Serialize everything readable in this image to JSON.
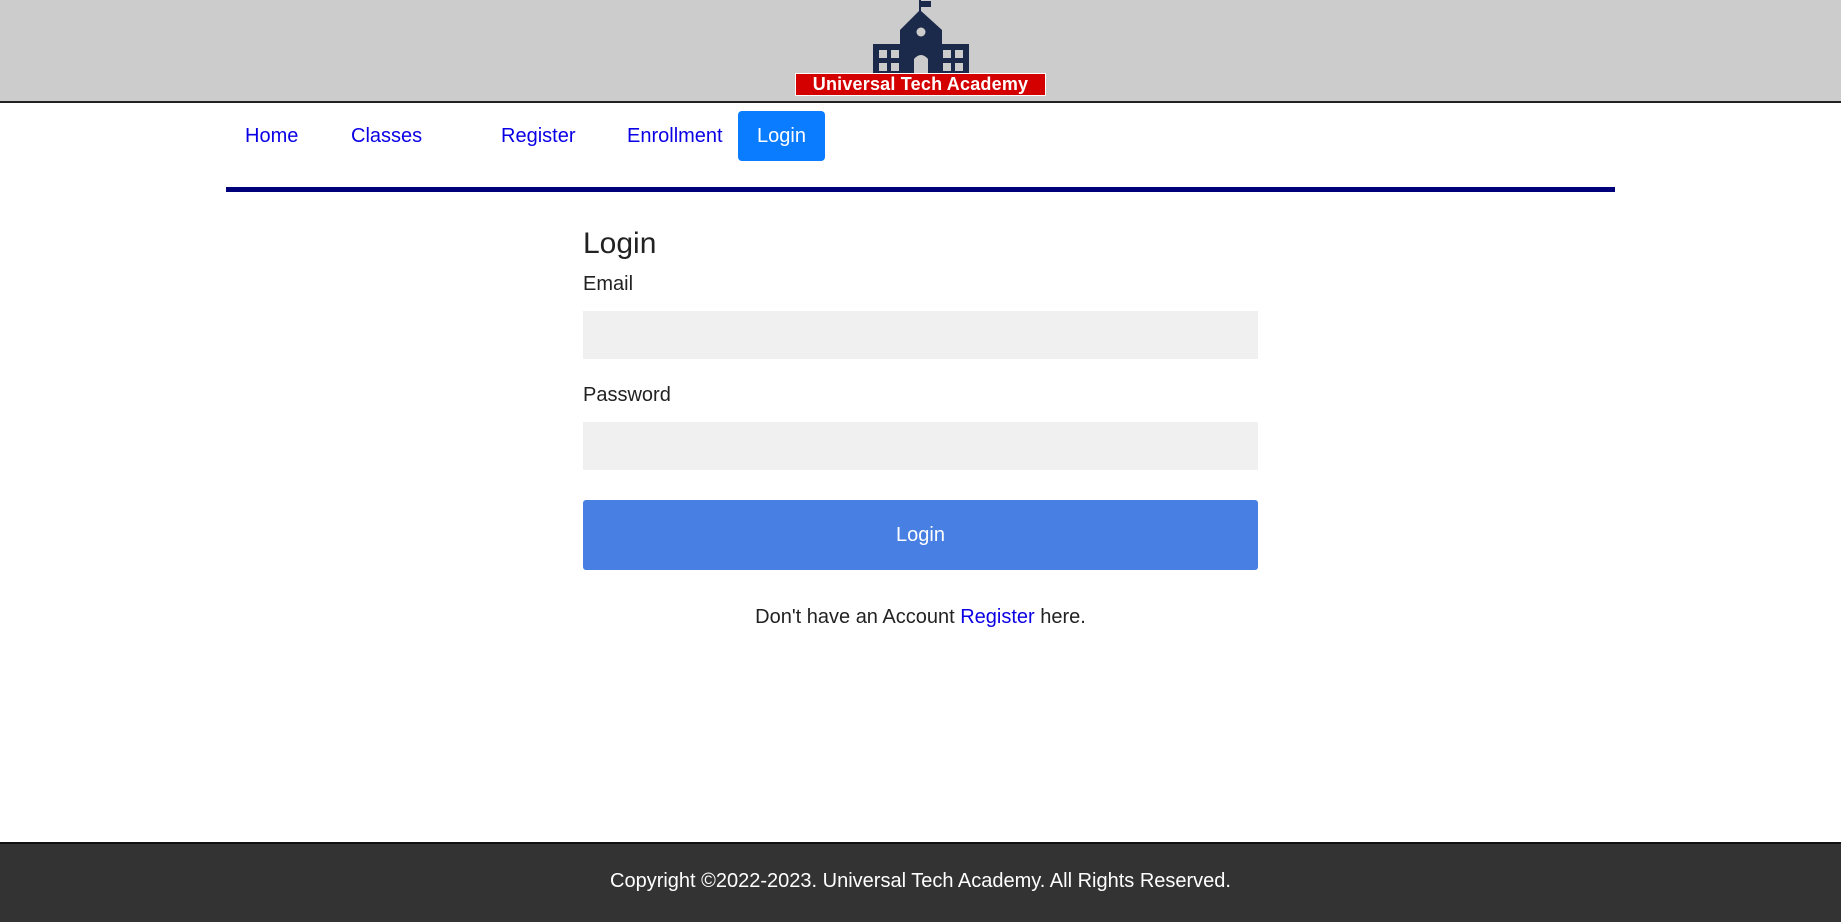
{
  "header": {
    "logo_text": "Universal Tech Academy",
    "colors": {
      "logo_navy": "#1b2a4a",
      "logo_banner_red": "#d40000",
      "header_background": "#cccccc"
    }
  },
  "nav": {
    "items": [
      {
        "label": "Home",
        "active": false
      },
      {
        "label": "Classes",
        "active": false
      },
      {
        "label": "Register",
        "active": false
      },
      {
        "label": "Enrollment",
        "active": false
      },
      {
        "label": "Login",
        "active": true
      }
    ],
    "colors": {
      "link": "#0a00e6",
      "active_background": "#0a7cff",
      "underline": "#00007a"
    }
  },
  "login": {
    "title": "Login",
    "email_label": "Email",
    "email_value": "",
    "password_label": "Password",
    "password_value": "",
    "submit_label": "Login",
    "register_prompt_before": "Don't have an Account",
    "register_link": "Register",
    "register_prompt_after": "here.",
    "colors": {
      "button": "#477fe3",
      "input_background": "#f0f0f0"
    }
  },
  "footer": {
    "text": "Copyright ©2022-2023. Universal Tech Academy. All Rights Reserved.",
    "colors": {
      "background": "#333333"
    }
  }
}
